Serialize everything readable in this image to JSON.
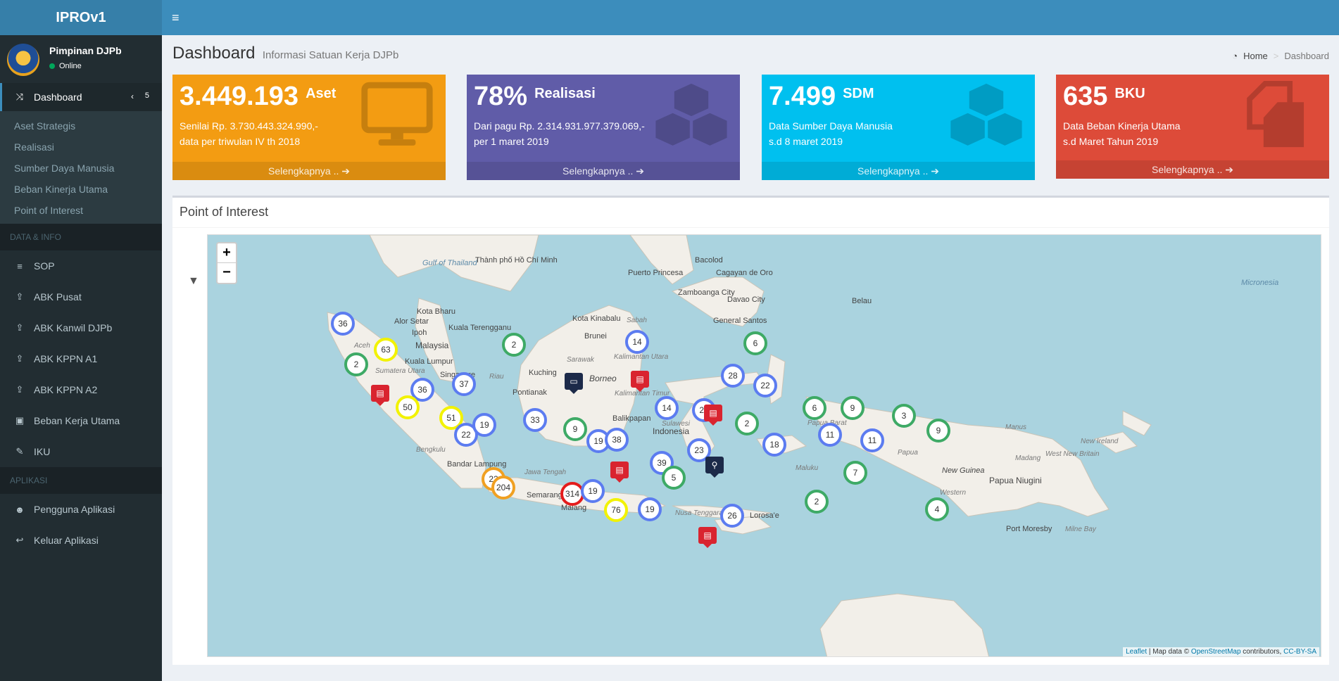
{
  "app": {
    "title": "IPROv1"
  },
  "user": {
    "name": "Pimpinan DJPb",
    "status": "Online"
  },
  "sidebar": {
    "active": {
      "label": "Dashboard",
      "badge": "5"
    },
    "submenu": [
      "Aset Strategis",
      "Realisasi",
      "Sumber Daya Manusia",
      "Beban Kinerja Utama",
      "Point of Interest"
    ],
    "header_data": "DATA & INFO",
    "data_items": [
      "SOP",
      "ABK Pusat",
      "ABK Kanwil DJPb",
      "ABK KPPN A1",
      "ABK KPPN A2",
      "Beban Kerja Utama",
      "IKU"
    ],
    "header_app": "APLIKASI",
    "app_items": [
      "Pengguna Aplikasi",
      "Keluar Aplikasi"
    ]
  },
  "header": {
    "title": "Dashboard",
    "subtitle": "Informasi Satuan Kerja DJPb",
    "breadcrumb_home": "Home",
    "breadcrumb_current": "Dashboard"
  },
  "boxes": [
    {
      "value": "3.449.193",
      "unit": "Aset",
      "line1": "Senilai Rp. 3.730.443.324.990,-",
      "line2": "data per triwulan IV th 2018",
      "footer": "Selengkapnya ..",
      "color": "#f39c12"
    },
    {
      "value": "78%",
      "unit": "Realisasi",
      "line1": "Dari pagu Rp. 2.314.931.977.379.069,-",
      "line2": "per 1 maret 2019",
      "footer": "Selengkapnya ..",
      "color": "#605ca8"
    },
    {
      "value": "7.499",
      "unit": "SDM",
      "line1": "Data Sumber Daya Manusia",
      "line2": "s.d 8 maret 2019",
      "footer": "Selengkapnya ..",
      "color": "#00c0ef"
    },
    {
      "value": "635",
      "unit": "BKU",
      "line1": "Data Beban Kinerja Utama",
      "line2": "s.d Maret Tahun 2019",
      "footer": "Selengkapnya ..",
      "color": "#dd4b39"
    }
  ],
  "poi": {
    "title": "Point of Interest",
    "zoom_in": "+",
    "zoom_out": "−",
    "attribution_leaflet": "Leaflet",
    "attribution_text": " | Map data © ",
    "attribution_osm": "OpenStreetMap",
    "attribution_contrib": " contributors, ",
    "attribution_cc": "CC-BY-SA",
    "labels": [
      "Gulf of Thailand",
      "Thành phố Hồ Chí Minh",
      "Puerto Princesa",
      "Bacolod",
      "Cagayan de Oro",
      "Zamboanga City",
      "Davao City",
      "General Santos",
      "Belau",
      "Micronesia",
      "Kota Bharu",
      "Alor Setar",
      "Ipoh",
      "Kuala Terengganu",
      "Malaysia",
      "Kuala Lumpur",
      "Singapore",
      "Kota Kinabalu",
      "Brunei",
      "Sabah",
      "Sarawak",
      "Kuching",
      "Pontianak",
      "Borneo",
      "Kalimantan Utara",
      "Kalimantan Timur",
      "Balikpapan",
      "Sulawesi",
      "Indonesia",
      "Aceh",
      "Sumatera Utara",
      "Riau",
      "Bengkulu",
      "Bandar Lampung",
      "Jawa Tengah",
      "Semarang",
      "Malang",
      "Nusa Tenggara Timur",
      "Lorosa'e",
      "Maluku",
      "Papua Barat",
      "Papua",
      "Manus",
      "New Ireland",
      "West New Britain",
      "New Guinea",
      "Papua Niugini",
      "Madang",
      "Western",
      "Port Moresby",
      "Milne Bay"
    ],
    "clusters": [
      {
        "n": "36",
        "c": "blue"
      },
      {
        "n": "63",
        "c": "yellow"
      },
      {
        "n": "2",
        "c": "green"
      },
      {
        "n": "36",
        "c": "blue"
      },
      {
        "n": "50",
        "c": "yellow"
      },
      {
        "n": "37",
        "c": "blue"
      },
      {
        "n": "51",
        "c": "yellow"
      },
      {
        "n": "22",
        "c": "blue"
      },
      {
        "n": "19",
        "c": "blue"
      },
      {
        "n": "2",
        "c": "green"
      },
      {
        "n": "33",
        "c": "blue"
      },
      {
        "n": "22",
        "c": "orange"
      },
      {
        "n": "204",
        "c": "orange"
      },
      {
        "n": "314",
        "c": "red"
      },
      {
        "n": "19",
        "c": "blue"
      },
      {
        "n": "76",
        "c": "yellow"
      },
      {
        "n": "19",
        "c": "blue"
      },
      {
        "n": "9",
        "c": "green"
      },
      {
        "n": "19",
        "c": "blue"
      },
      {
        "n": "38",
        "c": "blue"
      },
      {
        "n": "14",
        "c": "blue"
      },
      {
        "n": "14",
        "c": "blue"
      },
      {
        "n": "25",
        "c": "blue"
      },
      {
        "n": "39",
        "c": "blue"
      },
      {
        "n": "5",
        "c": "green"
      },
      {
        "n": "23",
        "c": "blue"
      },
      {
        "n": "28",
        "c": "blue"
      },
      {
        "n": "6",
        "c": "green"
      },
      {
        "n": "22",
        "c": "blue"
      },
      {
        "n": "2",
        "c": "green"
      },
      {
        "n": "18",
        "c": "blue"
      },
      {
        "n": "6",
        "c": "green"
      },
      {
        "n": "9",
        "c": "green"
      },
      {
        "n": "11",
        "c": "blue"
      },
      {
        "n": "11",
        "c": "blue"
      },
      {
        "n": "3",
        "c": "green"
      },
      {
        "n": "9",
        "c": "green"
      },
      {
        "n": "7",
        "c": "green"
      },
      {
        "n": "2",
        "c": "green"
      },
      {
        "n": "26",
        "c": "blue"
      },
      {
        "n": "4",
        "c": "green"
      }
    ],
    "markers": [
      "bus",
      "bus",
      "bus",
      "bus",
      "bus",
      "bus",
      "bed",
      "pin"
    ]
  },
  "icons": [
    "hamburger-icon",
    "shuffle-icon",
    "chevron-left-icon",
    "list-icon",
    "upload-icon",
    "briefcase-icon",
    "wrench-icon",
    "users-icon",
    "reply-icon",
    "dashboard-icon",
    "arrow-circle-right-icon",
    "filter-icon",
    "monitor-icon",
    "cubes-icon",
    "copy-icon",
    "bus-icon",
    "bed-icon",
    "pin-icon"
  ]
}
